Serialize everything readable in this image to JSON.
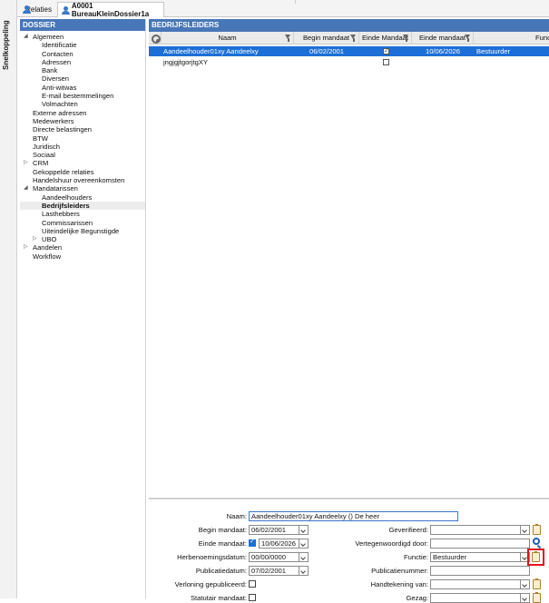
{
  "side_strip": {
    "label": "Snelkoppeling"
  },
  "tabs": [
    {
      "label": "Relaties"
    },
    {
      "label": "A0001 BureauKleinDossier1a"
    }
  ],
  "left_panel": {
    "header": "DOSSIER",
    "tree": [
      {
        "label": "Algemeen",
        "level": 1,
        "expanded": true
      },
      {
        "label": "Identificatie",
        "level": 2
      },
      {
        "label": "Contacten",
        "level": 2
      },
      {
        "label": "Adressen",
        "level": 2
      },
      {
        "label": "Bank",
        "level": 2
      },
      {
        "label": "Diversen",
        "level": 2
      },
      {
        "label": "Anti-witwas",
        "level": 2
      },
      {
        "label": "E-mail bestemmelingen",
        "level": 2
      },
      {
        "label": "Volmachten",
        "level": 2
      },
      {
        "label": "Externe adressen",
        "level": 1
      },
      {
        "label": "Medewerkers",
        "level": 1
      },
      {
        "label": "Directe belastingen",
        "level": 1
      },
      {
        "label": "BTW",
        "level": 1
      },
      {
        "label": "Juridisch",
        "level": 1
      },
      {
        "label": "Sociaal",
        "level": 1
      },
      {
        "label": "CRM",
        "level": 1,
        "collapsed": true
      },
      {
        "label": "Gekoppelde relaties",
        "level": 1
      },
      {
        "label": "Handelshuur overeenkomsten",
        "level": 1
      },
      {
        "label": "Mandatarissen",
        "level": 1,
        "expanded": true
      },
      {
        "label": "Aandeelhouders",
        "level": 2
      },
      {
        "label": "Bedrijfsleiders",
        "level": 2,
        "selected": true
      },
      {
        "label": "Lasthebbers",
        "level": 2
      },
      {
        "label": "Commissarissen",
        "level": 2
      },
      {
        "label": "Uiteindelijke Begunstigde",
        "level": 2
      },
      {
        "label": "UBO",
        "level": 2,
        "collapsed": true
      },
      {
        "label": "Aandelen",
        "level": 1,
        "collapsed": true
      },
      {
        "label": "Workflow",
        "level": 1
      }
    ]
  },
  "main": {
    "header": "BEDRIJFSLEIDERS",
    "columns": [
      {
        "label": "Naam"
      },
      {
        "label": "Begin mandaat"
      },
      {
        "label": "Einde Mandaat"
      },
      {
        "label": "Einde mandaat"
      },
      {
        "label": "Functie"
      }
    ],
    "rows": [
      {
        "naam": "Aandeelhouder01xy Aandeelxy",
        "begin": "06/02/2001",
        "einde_mandaat_checked": true,
        "einde": "10/06/2026",
        "functie": "Bestuurder",
        "selected": true
      },
      {
        "naam": "jngjgjtgorjtgXY",
        "begin": "",
        "einde_mandaat_checked": false,
        "einde": "",
        "functie": "",
        "selected": false
      }
    ]
  },
  "form": {
    "naam_label": "Naam:",
    "naam_value": "Aandeelhouder01xy Aandeelxy () De heer",
    "begin_label": "Begin mandaat:",
    "begin_value": "06/02/2001",
    "einde_label": "Einde mandaat:",
    "einde_value": "10/06/2026",
    "herbenoeming_label": "Herbenoemingsdatum:",
    "herbenoeming_value": "00/00/0000",
    "publicatie_label": "Publicatiedatum:",
    "publicatie_value": "07/02/2001",
    "verloning_label": "Verloning gepubliceerd:",
    "statutair_label": "Statutair mandaat:",
    "geverifieerd_label": "Geverifieerd:",
    "geverifieerd_value": "",
    "vertegenwoordigd_label": "Vertegenwoordigd door:",
    "vertegenwoordigd_value": "",
    "functie_label": "Functie:",
    "functie_value": "Bestuurder",
    "publicatienummer_label": "Publicatienummer:",
    "publicatienummer_value": "",
    "handtekening_label": "Handtekening van:",
    "handtekening_value": "",
    "gezag_label": "Gezag:",
    "gezag_value": ""
  }
}
